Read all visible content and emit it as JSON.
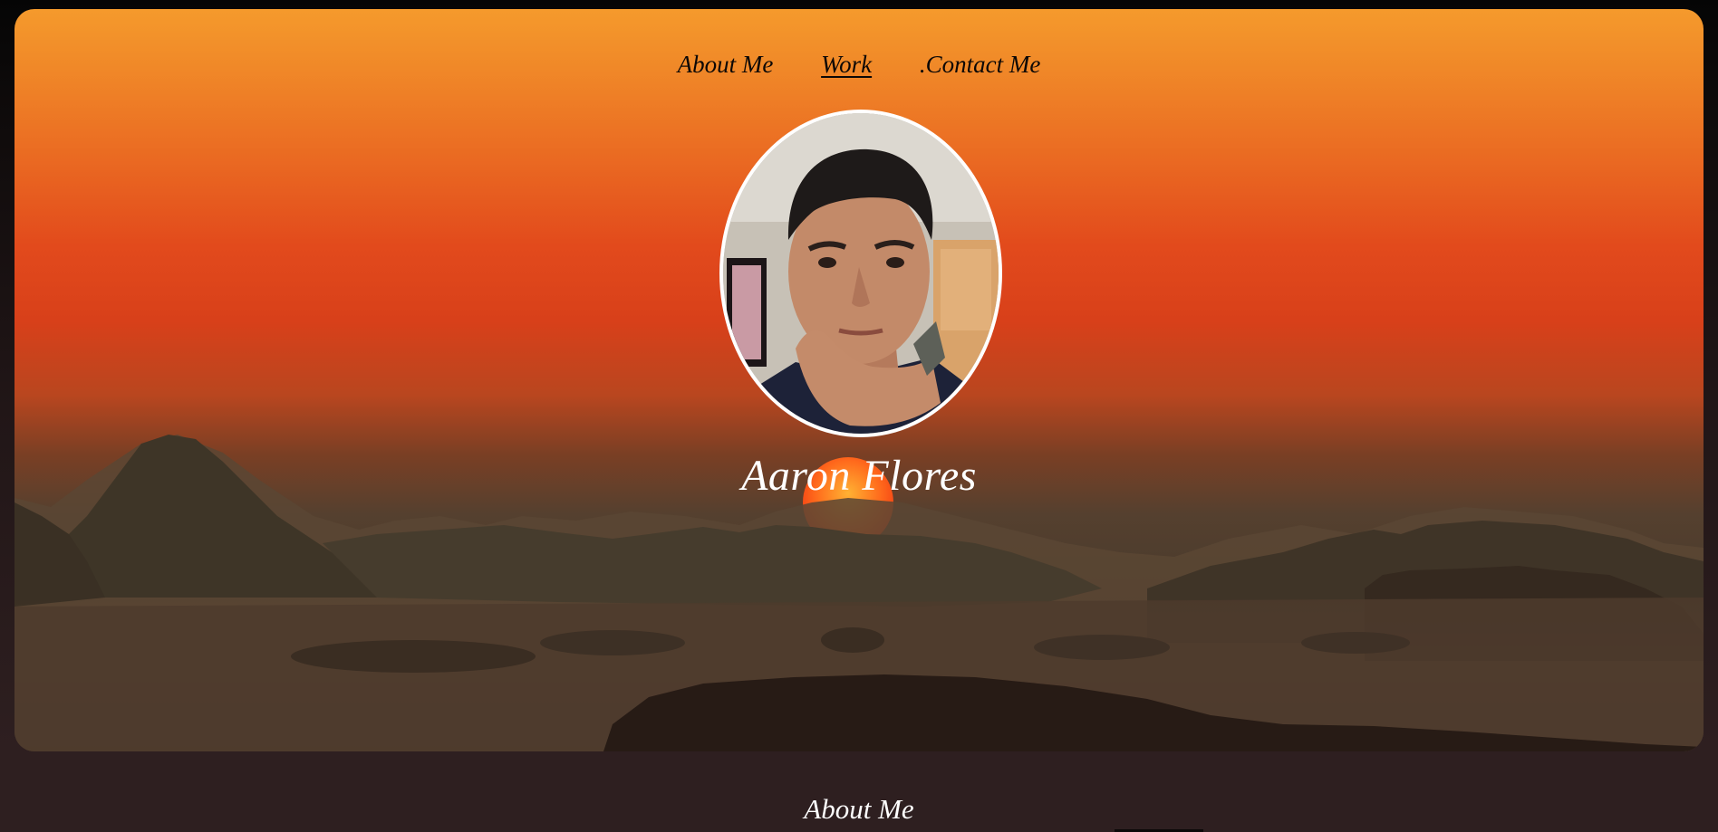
{
  "nav": {
    "items": [
      {
        "label": "About Me"
      },
      {
        "label": "Work"
      },
      {
        "label": ".Contact Me"
      }
    ]
  },
  "hero": {
    "name": "Aaron Flores"
  },
  "section": {
    "title": "About Me"
  },
  "colors": {
    "sky_top": "#f59a2c",
    "sky_mid": "#e24a1c",
    "page_bg": "#2e1f20",
    "text_light": "#ffffff",
    "nav_text": "#0c0806"
  }
}
